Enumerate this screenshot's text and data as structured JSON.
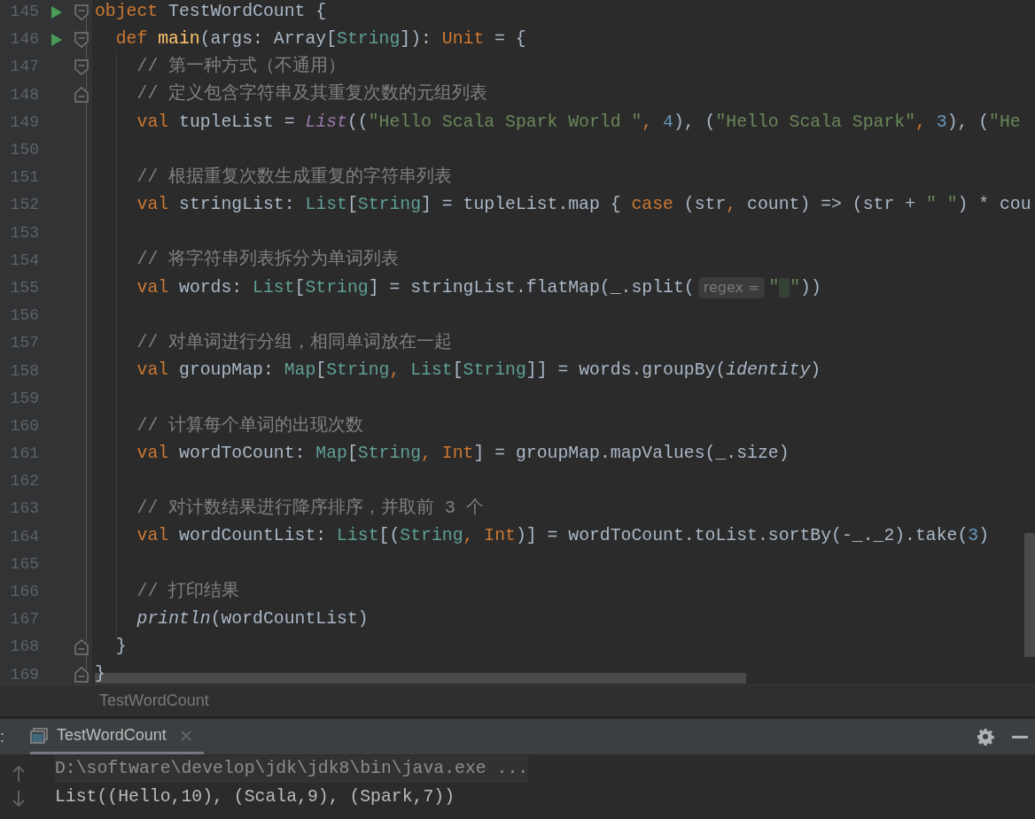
{
  "editor": {
    "lines": [
      {
        "number": "145",
        "run": true,
        "fold_start": true,
        "fold_end": false,
        "tokens": [
          {
            "kind": "kw",
            "text": "object"
          },
          {
            "kind": "id",
            "text": " TestWordCount {"
          }
        ]
      },
      {
        "number": "146",
        "run": true,
        "fold_start": true,
        "fold_end": false,
        "tokens": [
          {
            "kind": "kw",
            "text": "  def "
          },
          {
            "kind": "decl",
            "text": "main"
          },
          {
            "kind": "id",
            "text": "(args: Array["
          },
          {
            "kind": "ty",
            "text": "String"
          },
          {
            "kind": "id",
            "text": "]): "
          },
          {
            "kind": "kw",
            "text": "Unit"
          },
          {
            "kind": "id",
            "text": " = {"
          }
        ]
      },
      {
        "number": "147",
        "run": false,
        "fold_start": true,
        "fold_end": false,
        "tokens": [
          {
            "kind": "cmt",
            "text": "    // 第一种方式（不通用）"
          }
        ]
      },
      {
        "number": "148",
        "run": false,
        "fold_start": false,
        "fold_end": true,
        "tokens": [
          {
            "kind": "cmt",
            "text": "    // 定义包含字符串及其重复次数的元组列表"
          }
        ]
      },
      {
        "number": "149",
        "run": false,
        "fold_start": false,
        "fold_end": false,
        "tokens": [
          {
            "kind": "kw",
            "text": "    val"
          },
          {
            "kind": "id",
            "text": " tupleList = "
          },
          {
            "kind": "fn",
            "text": "List"
          },
          {
            "kind": "id",
            "text": "(("
          },
          {
            "kind": "str",
            "text": "\"Hello Scala Spark World \""
          },
          {
            "kind": "kw",
            "text": ", "
          },
          {
            "kind": "num",
            "text": "4"
          },
          {
            "kind": "id",
            "text": "), ("
          },
          {
            "kind": "str",
            "text": "\"Hello Scala Spark\""
          },
          {
            "kind": "kw",
            "text": ", "
          },
          {
            "kind": "num",
            "text": "3"
          },
          {
            "kind": "id",
            "text": "), ("
          },
          {
            "kind": "str",
            "text": "\"He"
          }
        ]
      },
      {
        "number": "150",
        "run": false,
        "fold_start": false,
        "fold_end": false
      },
      {
        "number": "151",
        "run": false,
        "fold_start": false,
        "fold_end": false,
        "tokens": [
          {
            "kind": "cmt",
            "text": "    // 根据重复次数生成重复的字符串列表"
          }
        ]
      },
      {
        "number": "152",
        "run": false,
        "fold_start": false,
        "fold_end": false,
        "tokens": [
          {
            "kind": "kw",
            "text": "    val"
          },
          {
            "kind": "id",
            "text": " stringList: "
          },
          {
            "kind": "ty",
            "text": "List"
          },
          {
            "kind": "id",
            "text": "["
          },
          {
            "kind": "ty",
            "text": "String"
          },
          {
            "kind": "id",
            "text": "] = tupleList.map { "
          },
          {
            "kind": "kw",
            "text": "case"
          },
          {
            "kind": "id",
            "text": " (str"
          },
          {
            "kind": "kw",
            "text": ", "
          },
          {
            "kind": "id",
            "text": "count) => (str + "
          },
          {
            "kind": "str",
            "text": "\" \""
          },
          {
            "kind": "id",
            "text": ") * cou"
          }
        ]
      },
      {
        "number": "153",
        "run": false,
        "fold_start": false,
        "fold_end": false
      },
      {
        "number": "154",
        "run": false,
        "fold_start": false,
        "fold_end": false,
        "tokens": [
          {
            "kind": "cmt",
            "text": "    // 将字符串列表拆分为单词列表"
          }
        ]
      },
      {
        "number": "155",
        "run": false,
        "fold_start": false,
        "fold_end": false,
        "tokens": [
          {
            "kind": "kw",
            "text": "    val"
          },
          {
            "kind": "id",
            "text": " words: "
          },
          {
            "kind": "ty",
            "text": "List"
          },
          {
            "kind": "id",
            "text": "["
          },
          {
            "kind": "ty",
            "text": "String"
          },
          {
            "kind": "id",
            "text": "] = stringList.flatMap(_.split("
          },
          {
            "kind": "hint",
            "text": "regex ="
          },
          {
            "kind": "str",
            "text": "\" \"",
            "caret": true
          },
          {
            "kind": "id",
            "text": "))"
          }
        ]
      },
      {
        "number": "156",
        "run": false,
        "fold_start": false,
        "fold_end": false
      },
      {
        "number": "157",
        "run": false,
        "fold_start": false,
        "fold_end": false,
        "tokens": [
          {
            "kind": "cmt",
            "text": "    // 对单词进行分组，相同单词放在一起"
          }
        ]
      },
      {
        "number": "158",
        "run": false,
        "fold_start": false,
        "fold_end": false,
        "tokens": [
          {
            "kind": "kw",
            "text": "    val"
          },
          {
            "kind": "id",
            "text": " groupMap: "
          },
          {
            "kind": "ty",
            "text": "Map"
          },
          {
            "kind": "id",
            "text": "["
          },
          {
            "kind": "ty",
            "text": "String"
          },
          {
            "kind": "kw",
            "text": ", "
          },
          {
            "kind": "ty",
            "text": "List"
          },
          {
            "kind": "id",
            "text": "["
          },
          {
            "kind": "ty",
            "text": "String"
          },
          {
            "kind": "id",
            "text": "]] = words.groupBy("
          },
          {
            "kind": "it",
            "text": "identity"
          },
          {
            "kind": "id",
            "text": ")"
          }
        ]
      },
      {
        "number": "159",
        "run": false,
        "fold_start": false,
        "fold_end": false
      },
      {
        "number": "160",
        "run": false,
        "fold_start": false,
        "fold_end": false,
        "tokens": [
          {
            "kind": "cmt",
            "text": "    // 计算每个单词的出现次数"
          }
        ]
      },
      {
        "number": "161",
        "run": false,
        "fold_start": false,
        "fold_end": false,
        "tokens": [
          {
            "kind": "kw",
            "text": "    val"
          },
          {
            "kind": "id",
            "text": " wordToCount: "
          },
          {
            "kind": "ty",
            "text": "Map"
          },
          {
            "kind": "id",
            "text": "["
          },
          {
            "kind": "ty",
            "text": "String"
          },
          {
            "kind": "kw",
            "text": ", Int"
          },
          {
            "kind": "id",
            "text": "] = groupMap.mapValues(_.size)"
          }
        ]
      },
      {
        "number": "162",
        "run": false,
        "fold_start": false,
        "fold_end": false
      },
      {
        "number": "163",
        "run": false,
        "fold_start": false,
        "fold_end": false,
        "tokens": [
          {
            "kind": "cmt",
            "text": "    // 对计数结果进行降序排序，并取前 3 个"
          }
        ]
      },
      {
        "number": "164",
        "run": false,
        "fold_start": false,
        "fold_end": false,
        "tokens": [
          {
            "kind": "kw",
            "text": "    val"
          },
          {
            "kind": "id",
            "text": " wordCountList: "
          },
          {
            "kind": "ty",
            "text": "List"
          },
          {
            "kind": "id",
            "text": "[("
          },
          {
            "kind": "ty",
            "text": "String"
          },
          {
            "kind": "kw",
            "text": ", Int"
          },
          {
            "kind": "id",
            "text": ")] = wordToCount.toList.sortBy(-_._2).take("
          },
          {
            "kind": "num",
            "text": "3"
          },
          {
            "kind": "id",
            "text": ")"
          }
        ]
      },
      {
        "number": "165",
        "run": false,
        "fold_start": false,
        "fold_end": false
      },
      {
        "number": "166",
        "run": false,
        "fold_start": false,
        "fold_end": false,
        "tokens": [
          {
            "kind": "cmt",
            "text": "    // 打印结果"
          }
        ]
      },
      {
        "number": "167",
        "run": false,
        "fold_start": false,
        "fold_end": false,
        "tokens": [
          {
            "kind": "it",
            "text": "    println"
          },
          {
            "kind": "id",
            "text": "(wordCountList)"
          }
        ]
      },
      {
        "number": "168",
        "run": false,
        "fold_start": false,
        "fold_end": true,
        "tokens": [
          {
            "kind": "id",
            "text": "  }"
          }
        ]
      },
      {
        "number": "169",
        "run": false,
        "fold_start": false,
        "fold_end": true,
        "tokens": [
          {
            "kind": "id",
            "text": "}"
          }
        ]
      }
    ]
  },
  "breadcrumb": "TestWordCount",
  "run_panel": {
    "label": ":",
    "tabs": [
      {
        "title": "TestWordCount",
        "selected": true
      }
    ],
    "console": [
      {
        "kind": "command",
        "text": "D:\\software\\develop\\jdk\\jdk8\\bin\\java.exe ..."
      },
      {
        "kind": "output",
        "text": "List((Hello,10), (Scala,9), (Spark,7))"
      }
    ]
  }
}
